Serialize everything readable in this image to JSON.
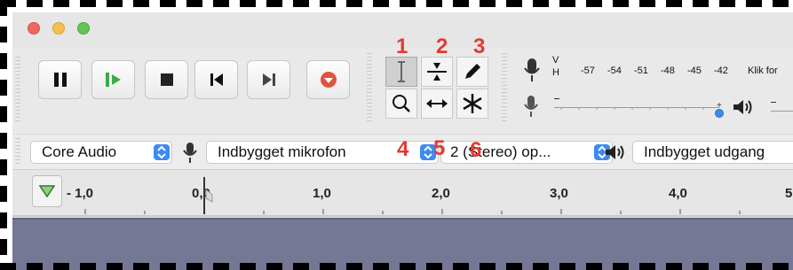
{
  "window": {
    "traffic_light_colors": [
      "#ed6a5e",
      "#f5bf4f",
      "#62c554"
    ]
  },
  "transport": {
    "buttons": [
      {
        "name": "pause",
        "icon": "pause-icon"
      },
      {
        "name": "play",
        "icon": "play-icon"
      },
      {
        "name": "stop",
        "icon": "stop-icon"
      },
      {
        "name": "skip-start",
        "icon": "skip-to-start-icon"
      },
      {
        "name": "skip-end",
        "icon": "skip-to-end-icon"
      },
      {
        "name": "record",
        "icon": "record-icon"
      }
    ]
  },
  "tools": {
    "items": [
      {
        "name": "selection-tool",
        "icon": "i-beam-icon",
        "annotation": "1",
        "selected": true
      },
      {
        "name": "envelope-tool",
        "icon": "envelope-icon",
        "annotation": "2"
      },
      {
        "name": "draw-tool",
        "icon": "pencil-icon",
        "annotation": "3"
      },
      {
        "name": "zoom-tool",
        "icon": "magnifier-icon",
        "annotation": "4"
      },
      {
        "name": "timeshift-tool",
        "icon": "double-arrow-icon",
        "annotation": "5"
      },
      {
        "name": "multi-tool",
        "icon": "asterisk-icon",
        "annotation": "6"
      }
    ],
    "annotation_color": "#e23a33"
  },
  "meter": {
    "channel_v": "V",
    "channel_h": "H",
    "ticks": [
      "-57",
      "-54",
      "-51",
      "-48",
      "-45",
      "-42"
    ],
    "click_text": "Klik for"
  },
  "devices": {
    "host": "Core Audio",
    "input_device": "Indbygget mikrofon",
    "channels": "2 (Stereo) op...",
    "output_device": "Indbygget udgang"
  },
  "ruler": {
    "labels": [
      "- 1,0",
      "0,0",
      "1,0",
      "2,0",
      "3,0",
      "4,0",
      "5"
    ]
  },
  "colors": {
    "accent_blue": "#3b8bf2",
    "track_bg": "#747894",
    "record_red": "#e0533e",
    "play_green": "#3fa84c"
  }
}
